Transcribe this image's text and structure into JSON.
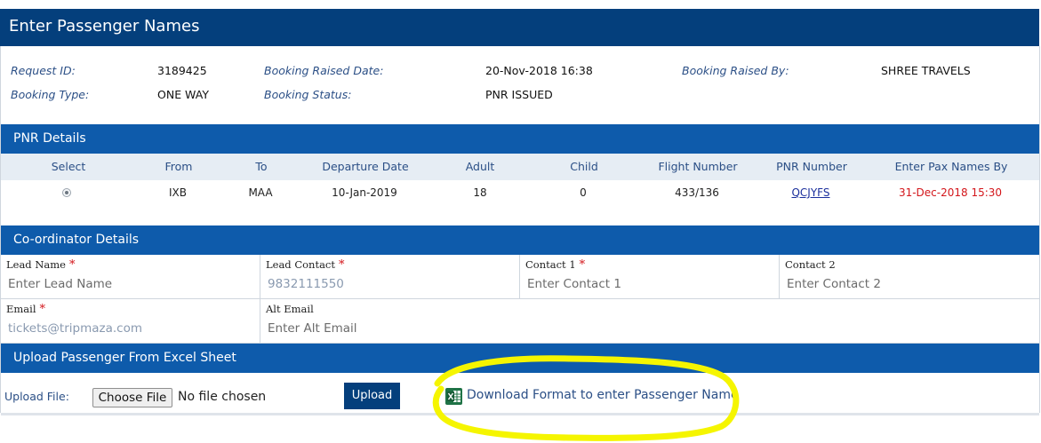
{
  "page": {
    "title": "Enter Passenger Names"
  },
  "request_info": {
    "request_id_label": "Request ID:",
    "request_id": "3189425",
    "raised_date_label": "Booking Raised Date:",
    "raised_date": "20-Nov-2018 16:38",
    "raised_by_label": "Booking Raised By:",
    "raised_by": "SHREE TRAVELS",
    "booking_type_label": "Booking Type:",
    "booking_type": "ONE WAY",
    "booking_status_label": "Booking Status:",
    "booking_status": "PNR ISSUED"
  },
  "pnr": {
    "section_title": "PNR Details",
    "columns": [
      "Select",
      "From",
      "To",
      "Departure Date",
      "Adult",
      "Child",
      "Flight Number",
      "PNR Number",
      "Enter Pax Names By"
    ],
    "row": {
      "from": "IXB",
      "to": "MAA",
      "departure_date": "10-Jan-2019",
      "adult": "18",
      "child": "0",
      "flight_number": "433/136",
      "pnr_number": "QCJYFS",
      "pax_names_by": "31-Dec-2018 15:30"
    }
  },
  "coordinator": {
    "section_title": "Co-ordinator Details",
    "lead_name_label": "Lead Name",
    "lead_name_placeholder": "Enter Lead Name",
    "lead_contact_label": "Lead Contact",
    "lead_contact_value": "9832111550",
    "contact1_label": "Contact 1",
    "contact1_placeholder": "Enter Contact 1",
    "contact2_label": "Contact 2",
    "contact2_placeholder": "Enter Contact 2",
    "email_label": "Email",
    "email_value": "tickets@tripmaza.com",
    "alt_email_label": "Alt Email",
    "alt_email_placeholder": "Enter Alt Email",
    "required_mark": "*"
  },
  "upload": {
    "section_title": "Upload Passenger From Excel Sheet",
    "file_label": "Upload File:",
    "choose_file_label": "Choose File",
    "no_file_text": "No file chosen",
    "upload_button": "Upload",
    "download_link": "Download Format to enter Passenger Name",
    "icon": "excel-icon"
  },
  "colors": {
    "title_bar": "#043f7c",
    "section_bar": "#0e5bab",
    "required": "#d3161b",
    "highlight": "#f5f500"
  }
}
